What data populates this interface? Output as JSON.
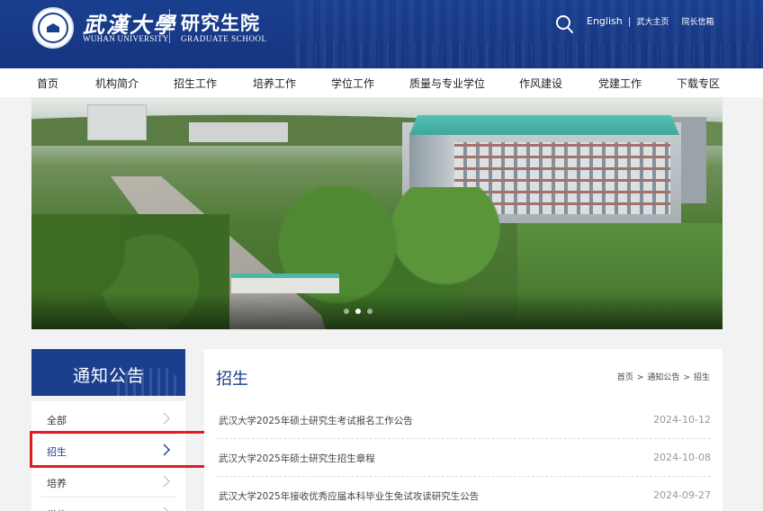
{
  "header": {
    "univ_cn": "武漢大學",
    "univ_en": "WUHAN UNIVERSITY",
    "school_cn": "研究生院",
    "school_en": "GRADUATE SCHOOL",
    "links": {
      "english": "English",
      "pipe": "|",
      "home": "武大主页",
      "mailbox": "院长信箱"
    },
    "icons": {
      "search": "search-icon",
      "emblem": "university-emblem"
    }
  },
  "nav": {
    "items": [
      "首页",
      "机构简介",
      "招生工作",
      "培养工作",
      "学位工作",
      "质量与专业学位",
      "作风建设",
      "党建工作",
      "下载专区"
    ]
  },
  "banner": {
    "slides": 3,
    "active_slide": 2
  },
  "sidebar": {
    "title": "通知公告",
    "items": [
      {
        "label": "全部",
        "active": false
      },
      {
        "label": "招生",
        "active": true
      },
      {
        "label": "培养",
        "active": false
      },
      {
        "label": "学位",
        "active": false
      }
    ],
    "icons": {
      "chevron": "chevron-right-icon"
    },
    "highlight_color": "#e01b24"
  },
  "main": {
    "title": "招生",
    "breadcrumb": [
      "首页",
      "通知公告",
      "招生"
    ],
    "breadcrumb_sep": ">",
    "notices": [
      {
        "title": "武汉大学2025年硕士研究生考试报名工作公告",
        "date": "2024-10-12"
      },
      {
        "title": "武汉大学2025年硕士研究生招生章程",
        "date": "2024-10-08"
      },
      {
        "title": "武汉大学2025年接收优秀应届本科毕业生免试攻读研究生公告",
        "date": "2024-09-27"
      }
    ]
  },
  "colors": {
    "brand": "#1a3f8f",
    "background": "#f2f2f2",
    "accent_roof": "#3ea79c"
  }
}
